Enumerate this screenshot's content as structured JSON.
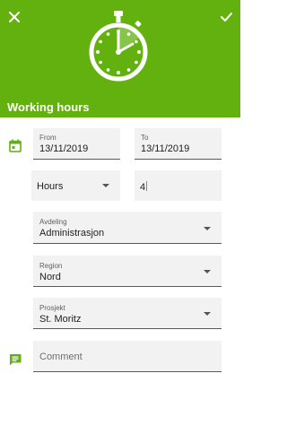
{
  "header": {
    "title": "Working hours",
    "color": "#62b10e"
  },
  "icons": {
    "close": "close-icon",
    "confirm": "check-icon",
    "timer": "stopwatch-icon",
    "date": "calendar-icon",
    "comment": "comment-icon"
  },
  "form": {
    "from": {
      "label": "From",
      "value": "13/11/2019"
    },
    "to": {
      "label": "To",
      "value": "13/11/2019"
    },
    "unit": {
      "value": "Hours"
    },
    "amount": {
      "value": "4"
    },
    "avdeling": {
      "label": "Avdeling",
      "value": "Administrasjon"
    },
    "region": {
      "label": "Region",
      "value": "Nord"
    },
    "prosjekt": {
      "label": "Prosjekt",
      "value": "St. Moritz"
    },
    "comment": {
      "placeholder": "Comment"
    }
  }
}
